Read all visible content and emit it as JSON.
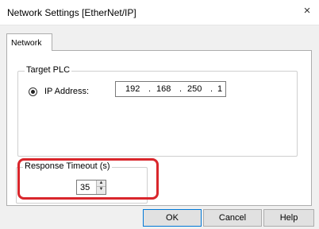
{
  "window": {
    "title": "Network Settings [EtherNet/IP]",
    "close_glyph": "×"
  },
  "tabs": [
    {
      "label": "Network"
    }
  ],
  "target_plc": {
    "group_label": "Target PLC",
    "radio_label": "IP Address:",
    "radio_checked": true,
    "ip": {
      "octet1": "192",
      "octet2": "168",
      "octet3": "250",
      "octet4": "1",
      "separator": "."
    }
  },
  "response_timeout": {
    "group_label": "Response Timeout (s)",
    "value": "35",
    "up_glyph": "▲",
    "down_glyph": "▼"
  },
  "buttons": {
    "ok": "OK",
    "cancel": "Cancel",
    "help": "Help"
  },
  "colors": {
    "highlight": "#d9262c",
    "default_button_border": "#0078d7"
  }
}
